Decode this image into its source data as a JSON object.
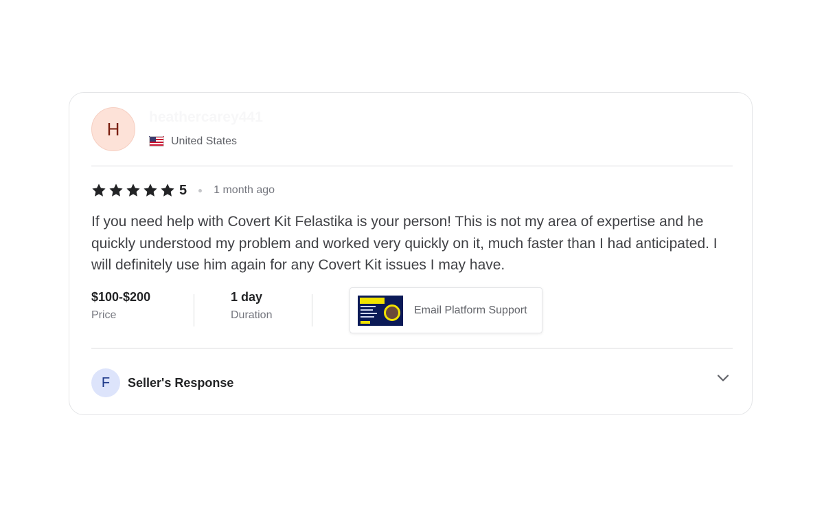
{
  "reviewer": {
    "initial": "H",
    "username": "heathercarey441",
    "country": "United States",
    "flag_icon": "us-flag-icon"
  },
  "rating": {
    "value": "5",
    "stars": 5,
    "max_stars": 5,
    "time_ago": "1 month ago"
  },
  "review": {
    "text": "If you need help with Covert Kit Felastika is your person! This is not my area of expertise and he quickly understood my problem and worked very quickly on it, much faster than I had anticipated. I will definitely use him again for any Covert Kit issues I may have."
  },
  "meta": {
    "price_value": "$100-$200",
    "price_label": "Price",
    "duration_value": "1 day",
    "duration_label": "Duration"
  },
  "gig": {
    "title": "Email Platform Support",
    "thumbnail_icon": "gig-thumbnail-image"
  },
  "seller_response": {
    "initial": "F",
    "label": "Seller's Response",
    "expand_icon": "chevron-down-icon"
  },
  "colors": {
    "star": "#222325",
    "avatar_bg": "#fde2d8",
    "seller_avatar_bg": "#dde4fb",
    "text_primary": "#222325",
    "text_secondary": "#74767e"
  }
}
